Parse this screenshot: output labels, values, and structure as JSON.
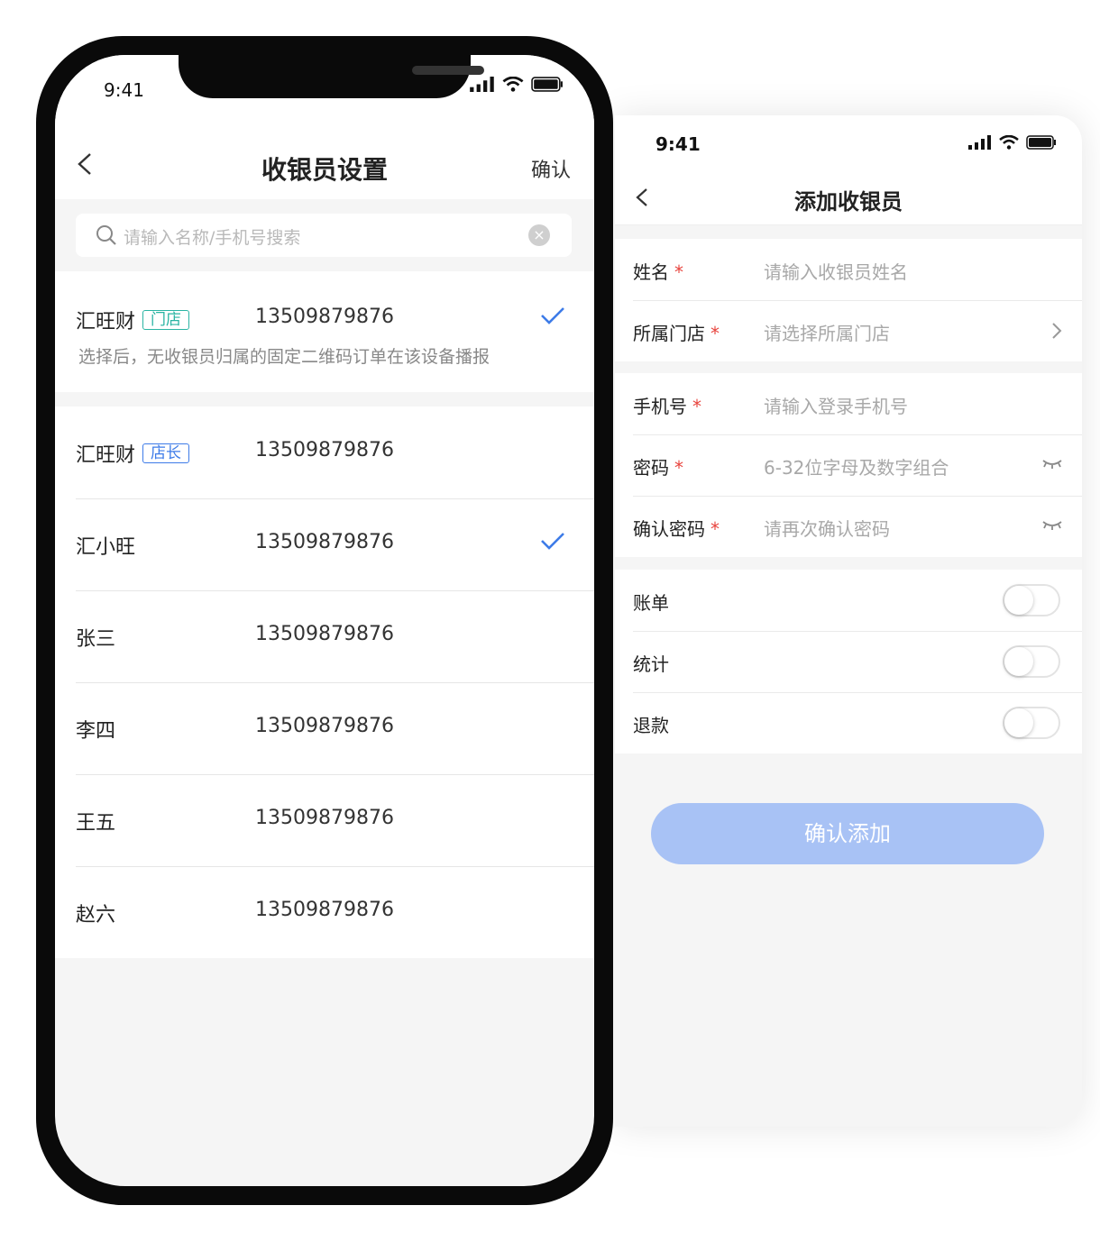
{
  "cashier_list": {
    "status_time": "9:41",
    "title": "收银员设置",
    "confirm_label": "确认",
    "search_placeholder": "请输入名称/手机号搜索",
    "selected_row": {
      "name": "汇旺财",
      "tag": "门店",
      "phone": "13509879876",
      "note": "选择后，无收银员归属的固定二维码订单在该设备播报"
    },
    "rows": [
      {
        "name": "汇旺财",
        "tag": "店长",
        "phone": "13509879876"
      },
      {
        "name": "汇小旺",
        "tag": "",
        "phone": "13509879876"
      },
      {
        "name": "张三",
        "tag": "",
        "phone": "13509879876"
      },
      {
        "name": "李四",
        "tag": "",
        "phone": "13509879876"
      },
      {
        "name": "王五",
        "tag": "",
        "phone": "13509879876"
      },
      {
        "name": "赵六",
        "tag": "",
        "phone": "13509879876"
      }
    ]
  },
  "add_cashier": {
    "status_time": "9:41",
    "title": "添加收银员",
    "fields_group1": [
      {
        "label": "姓名",
        "placeholder": "请输入收银员姓名"
      },
      {
        "label": "所属门店",
        "placeholder": "请选择所属门店"
      }
    ],
    "fields_group2": [
      {
        "label": "手机号",
        "placeholder": "请输入登录手机号"
      },
      {
        "label": "密码",
        "placeholder": "6-32位字母及数字组合"
      },
      {
        "label": "确认密码",
        "placeholder": "请再次确认密码"
      }
    ],
    "required_mark": "*",
    "permissions": [
      {
        "label": "账单",
        "enabled": false
      },
      {
        "label": "统计",
        "enabled": false
      },
      {
        "label": "退款",
        "enabled": false
      }
    ],
    "submit_label": "确认添加"
  },
  "colors": {
    "accent": "#3d7be8",
    "store_tag": "#2ab4a3",
    "required": "#e8433d",
    "submit_disabled": "#a8c2f5"
  },
  "icons": [
    "back-chevron-icon",
    "search-icon",
    "clear-icon",
    "checkmark-icon",
    "chevron-right-icon",
    "eye-closed-icon",
    "signal-icon",
    "wifi-icon",
    "battery-icon"
  ]
}
